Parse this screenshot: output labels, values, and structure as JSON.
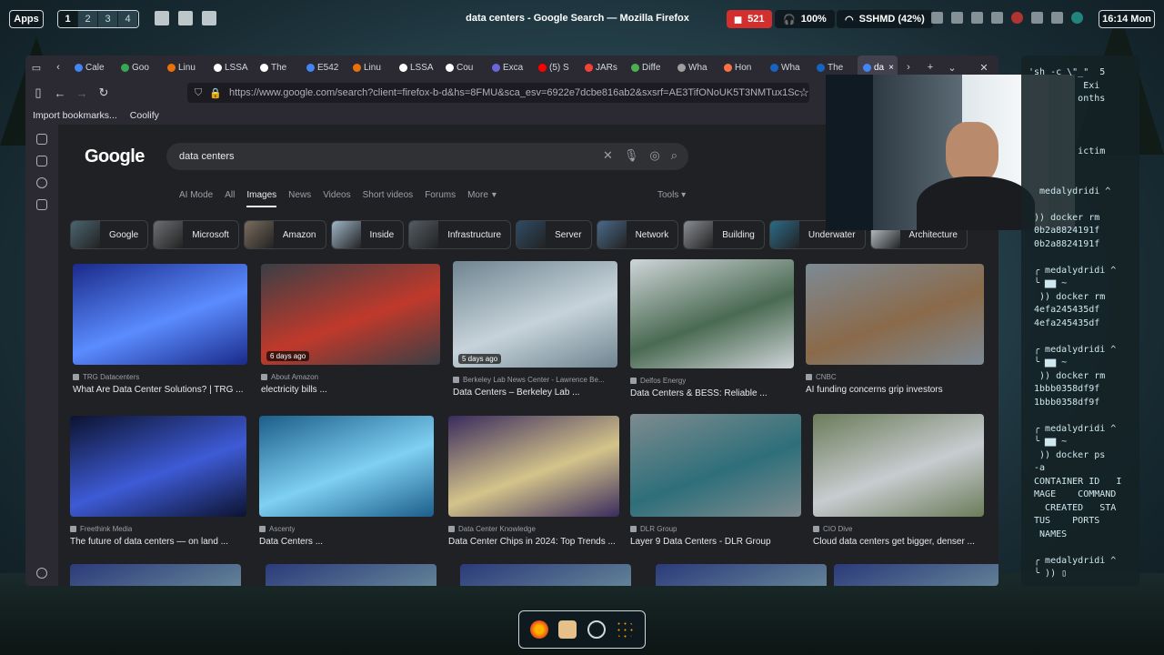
{
  "desktop": {
    "apps_label": "Apps",
    "workspaces": [
      "1",
      "2",
      "3",
      "4"
    ],
    "active_workspace": "1",
    "window_title": "data centers - Google Search — Mozilla Firefox",
    "notifications_count": "521",
    "volume": "100%",
    "wifi": "SSHMD (42%)",
    "clock": "16:14 Mon"
  },
  "browser": {
    "tabs": [
      {
        "label": "Cale",
        "color": "#4285f4"
      },
      {
        "label": "Goo",
        "color": "#34a853"
      },
      {
        "label": "Linu",
        "color": "#e8710a"
      },
      {
        "label": "LSSA",
        "color": "#ffffff"
      },
      {
        "label": "The",
        "color": "#ffffff"
      },
      {
        "label": "E542",
        "color": "#4285f4"
      },
      {
        "label": "Linu",
        "color": "#e8710a"
      },
      {
        "label": "LSSA",
        "color": "#ffffff"
      },
      {
        "label": "Cou",
        "color": "#ffffff"
      },
      {
        "label": "Exca",
        "color": "#6965db"
      },
      {
        "label": "(5) S",
        "color": "#ff0000"
      },
      {
        "label": "JARs",
        "color": "#f44336"
      },
      {
        "label": "Diffe",
        "color": "#4caf50"
      },
      {
        "label": "Wha",
        "color": "#9e9e9e"
      },
      {
        "label": "Hon",
        "color": "#ff7043"
      },
      {
        "label": "Wha",
        "color": "#1565c0"
      },
      {
        "label": "The",
        "color": "#1565c0"
      }
    ],
    "active_tab": {
      "label": "da",
      "color": "#4285f4"
    },
    "url": "https://www.google.com/search?client=firefox-b-d&hs=8FMU&sca_esv=6922e7dcbe816ab2&sxsrf=AE3TifONoUK5T3NMTux1Sc",
    "bookmarks": [
      "Import bookmarks...",
      "Coolify"
    ]
  },
  "google": {
    "logo": "Google",
    "query": "data centers",
    "filters": [
      "AI Mode",
      "All",
      "Images",
      "News",
      "Videos",
      "Short videos",
      "Forums",
      "More"
    ],
    "selected_filter": "Images",
    "tools": "Tools",
    "chips": [
      {
        "label": "Google",
        "color": "#4a6670"
      },
      {
        "label": "Microsoft",
        "color": "#6d6f72"
      },
      {
        "label": "Amazon",
        "color": "#7a6c5d"
      },
      {
        "label": "Inside",
        "color": "#9fb6c8"
      },
      {
        "label": "Infrastructure",
        "color": "#555c63"
      },
      {
        "label": "Server",
        "color": "#2f4c66"
      },
      {
        "label": "Network",
        "color": "#4a6a8a"
      },
      {
        "label": "Building",
        "color": "#8a8e93"
      },
      {
        "label": "Underwater",
        "color": "#2c6b8a"
      },
      {
        "label": "Architecture",
        "color": "#c9d2d8"
      }
    ],
    "results": [
      {
        "source": "TRG Datacenters",
        "title": "What Are Data Center Solutions? | TRG ...",
        "badge": "",
        "c1": "#1a2a8a",
        "c2": "#5b8cff"
      },
      {
        "source": "About Amazon",
        "title": "electricity bills ...",
        "badge": "6 days ago",
        "c1": "#3a3f45",
        "c2": "#c0392b"
      },
      {
        "source": "Berkeley Lab News Center - Lawrence Be...",
        "title": "Data Centers – Berkeley Lab ...",
        "badge": "5 days ago",
        "c1": "#6f8591",
        "c2": "#c7d3da"
      },
      {
        "source": "Delfos Energy",
        "title": "Data Centers & BESS: Reliable ...",
        "badge": "",
        "c1": "#cfd5d8",
        "c2": "#4a6a52"
      },
      {
        "source": "CNBC",
        "title": "AI funding concerns grip investors",
        "badge": "",
        "c1": "#7d8a95",
        "c2": "#8a6a4a"
      },
      {
        "source": "Freethink Media",
        "title": "The future of data centers — on land ...",
        "badge": "",
        "c1": "#0c1330",
        "c2": "#3e5bd6"
      },
      {
        "source": "Ascenty",
        "title": "Data Centers ...",
        "badge": "",
        "c1": "#1b5e8a",
        "c2": "#7fd0f2"
      },
      {
        "source": "Data Center Knowledge",
        "title": "Data Center Chips in 2024: Top Trends ...",
        "badge": "",
        "c1": "#3a2b5e",
        "c2": "#d4c48a"
      },
      {
        "source": "DLR Group",
        "title": "Layer 9 Data Centers - DLR Group",
        "badge": "",
        "c1": "#7e8b8f",
        "c2": "#2e6f7a"
      },
      {
        "source": "CIO Dive",
        "title": "Cloud data centers get bigger, denser ...",
        "badge": "",
        "c1": "#6b7c5a",
        "c2": "#c8ccd0"
      }
    ]
  },
  "terminal": {
    "text": "'sh -c \\\"_\"  5\n          Exi\n         onths\n\n\n\n         ictim\n\n\n  medalydridi ^\n\n )) docker rm\n 0b2a8824191f\n 0b2a8824191f\n\n ╭ medalydridi ^\n ╰ ▆▆ ~\n  )) docker rm\n 4efa245435df\n 4efa245435df\n\n ╭ medalydridi ^\n ╰ ▆▆ ~\n  )) docker rm\n 1bbb0358df9f\n 1bbb0358df9f\n\n ╭ medalydridi ^\n ╰ ▆▆ ~\n  )) docker ps\n -a\n CONTAINER ID   I\n MAGE    COMMAND\n   CREATED   STA\n TUS    PORTS\n  NAMES\n\n ╭ medalydridi ^\n ╰ )) ▯"
  }
}
